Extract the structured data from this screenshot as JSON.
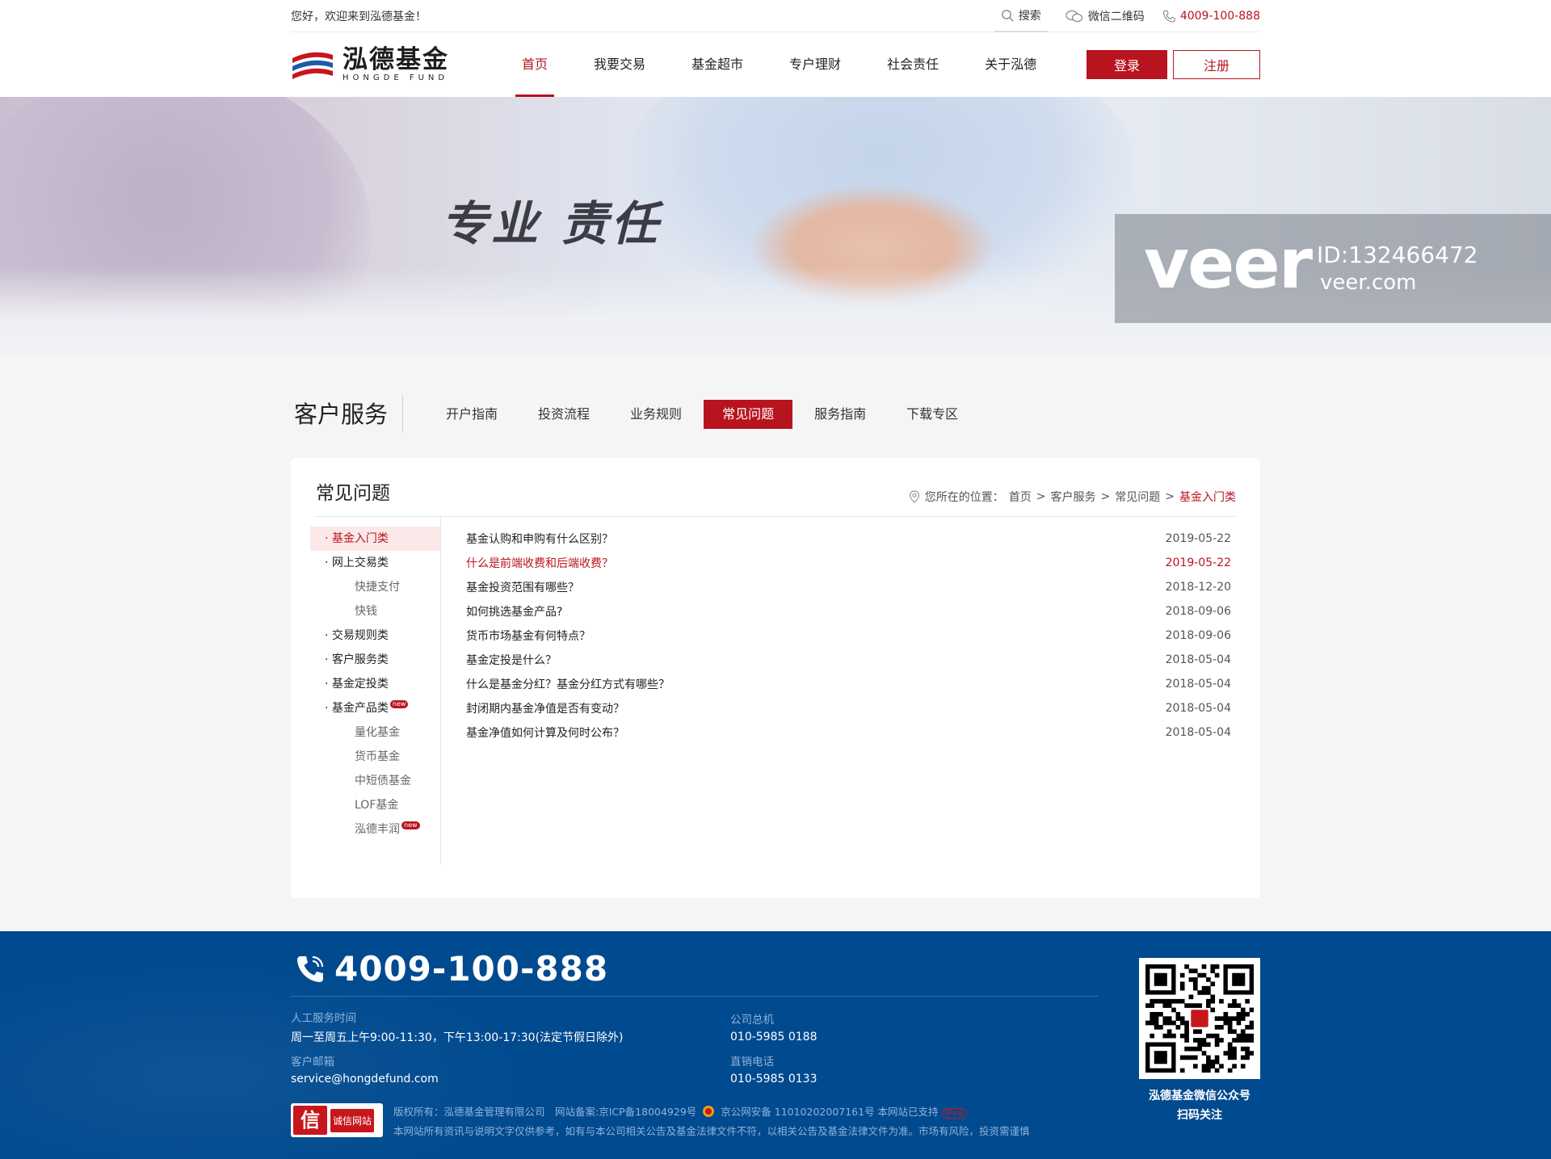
{
  "topbar": {
    "welcome": "您好，欢迎来到泓德基金！",
    "search": "搜索",
    "wechat": "微信二维码",
    "phone": "4009-100-888"
  },
  "header": {
    "logo_cn": "泓德基金",
    "logo_en": "HONGDE FUND",
    "nav": [
      "首页",
      "我要交易",
      "基金超市",
      "专户理财",
      "社会责任",
      "关于泓德"
    ],
    "login": "登录",
    "register": "注册"
  },
  "banner": {
    "slogan": "专业 责任",
    "watermark_brand": "veer",
    "watermark_id": "ID:132466472",
    "watermark_url": "veer.com"
  },
  "service": {
    "title": "客户服务",
    "tabs": [
      "开户指南",
      "投资流程",
      "业务规则",
      "常见问题",
      "服务指南",
      "下载专区"
    ],
    "active_tab": "常见问题"
  },
  "panel": {
    "title": "常见问题",
    "crumb_label": "您所在的位置：",
    "crumbs": [
      "首页",
      "客户服务",
      "常见问题",
      "基金入门类"
    ],
    "sep": ">"
  },
  "sidebar": [
    {
      "label": "· 基金入门类",
      "type": "main",
      "active": true
    },
    {
      "label": "· 网上交易类",
      "type": "main"
    },
    {
      "label": "快捷支付",
      "type": "sub"
    },
    {
      "label": "快钱",
      "type": "sub"
    },
    {
      "label": "· 交易规则类",
      "type": "main"
    },
    {
      "label": "· 客户服务类",
      "type": "main"
    },
    {
      "label": "· 基金定投类",
      "type": "main"
    },
    {
      "label": "· 基金产品类",
      "type": "main",
      "badge": "new"
    },
    {
      "label": "量化基金",
      "type": "sub"
    },
    {
      "label": "货币基金",
      "type": "sub"
    },
    {
      "label": "中短债基金",
      "type": "sub"
    },
    {
      "label": "LOF基金",
      "type": "sub"
    },
    {
      "label": "泓德丰润",
      "type": "sub",
      "badge": "new"
    }
  ],
  "questions": [
    {
      "title": "基金认购和申购有什么区别？",
      "date": "2019-05-22"
    },
    {
      "title": "什么是前端收费和后端收费？",
      "date": "2019-05-22",
      "highlight": true
    },
    {
      "title": "基金投资范围有哪些？",
      "date": "2018-12-20"
    },
    {
      "title": "如何挑选基金产品?",
      "date": "2018-09-06"
    },
    {
      "title": "货币市场基金有何特点？",
      "date": "2018-09-06"
    },
    {
      "title": "基金定投是什么？",
      "date": "2018-05-04"
    },
    {
      "title": "什么是基金分红？基金分红方式有哪些？",
      "date": "2018-05-04"
    },
    {
      "title": "封闭期内基金净值是否有变动？",
      "date": "2018-05-04"
    },
    {
      "title": "基金净值如何计算及何时公布？",
      "date": "2018-05-04"
    }
  ],
  "footer": {
    "phone": "4009-100-888",
    "hours_label": "人工服务时间",
    "hours": "周一至周五上午9:00-11:30，下午13:00-17:30(法定节假日除外)",
    "email_label": "客户邮箱",
    "email": "service@hongdefund.com",
    "hq_label": "公司总机",
    "hq": "010-5985 0188",
    "direct_label": "直销电话",
    "direct": "010-5985 0133",
    "badge_icon": "信",
    "badge_text": "诚信网站",
    "copyright": "版权所有：泓德基金管理有限公司　网站备案:京ICP备18004929号",
    "police": "京公网安备 11010202007161号 本网站已支持",
    "ipv6": "IPv6",
    "disclaimer": "本网站所有资讯与说明文字仅供参考，如有与本公司相关公告及基金法律文件不符，以相关公告及基金法律文件为准。市场有风险，投资需谨慎",
    "qr_caption_1": "泓德基金微信公众号",
    "qr_caption_2": "扫码关注"
  },
  "colors": {
    "brand_red": "#b8141f",
    "footer_blue": "#004a8f"
  }
}
